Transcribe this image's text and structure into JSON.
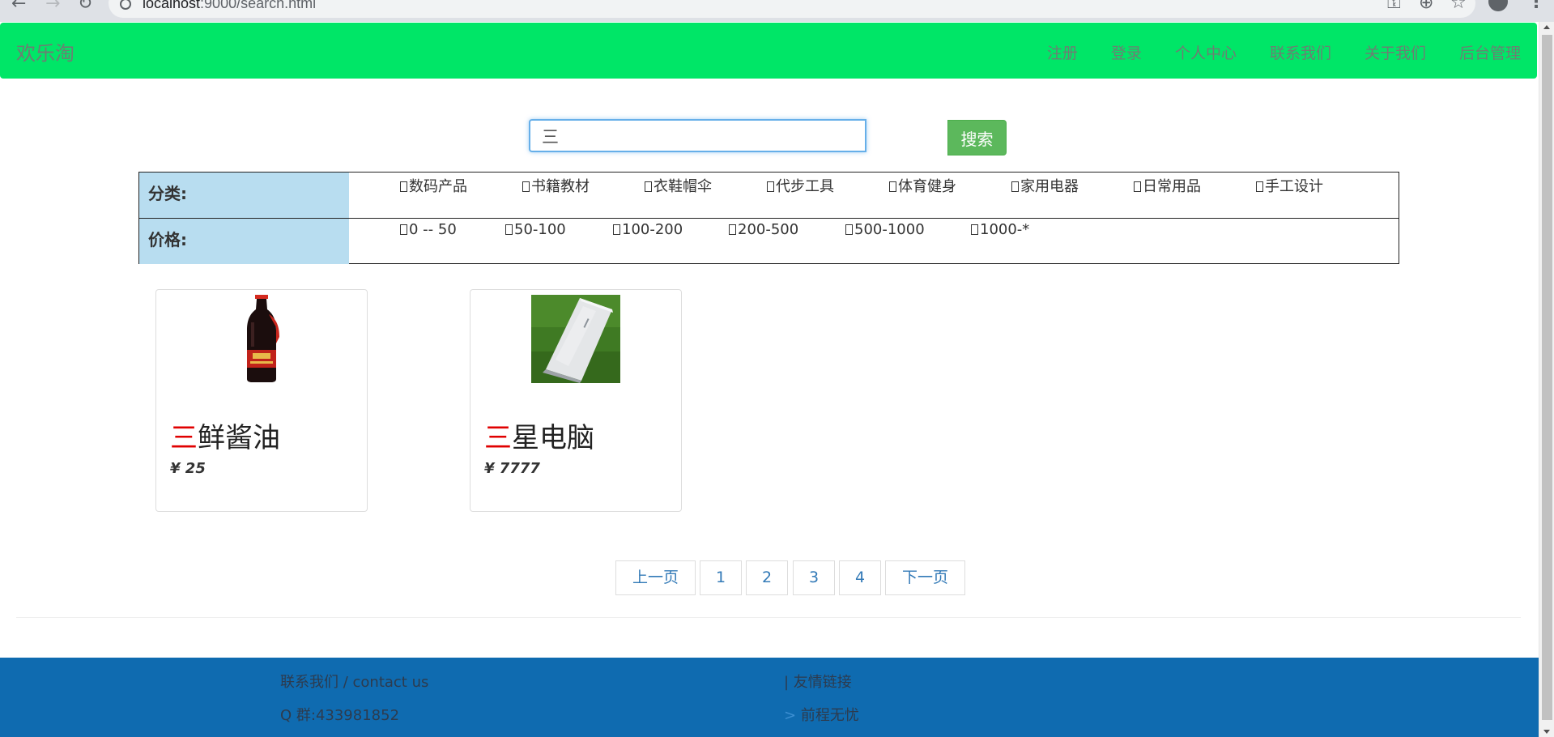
{
  "browser": {
    "url_host": "localhost",
    "url_rest": ":9000/search.html"
  },
  "navbar": {
    "brand": "欢乐淘",
    "links": [
      "注册",
      "登录",
      "个人中心",
      "联系我们",
      "关于我们",
      "后台管理"
    ]
  },
  "search": {
    "value": "三",
    "button_label": "搜索"
  },
  "filters": {
    "category_label": "分类:",
    "categories": [
      "数码产品",
      "书籍教材",
      "衣鞋帽伞",
      "代步工具",
      "体育健身",
      "家用电器",
      "日常用品",
      "手工设计"
    ],
    "price_label": "价格:",
    "prices": [
      "0 -- 50",
      "50-100",
      "100-200",
      "200-500",
      "500-1000",
      "1000-*"
    ]
  },
  "products": [
    {
      "highlight": "三",
      "name_rest": "鲜酱油",
      "price": "¥ 25",
      "image_icon": "soy-sauce-bottle"
    },
    {
      "highlight": "三",
      "name_rest": "星电脑",
      "price": "¥ 7777",
      "image_icon": "laptop-on-grass"
    }
  ],
  "pagination": {
    "prev": "上一页",
    "pages": [
      "1",
      "2",
      "3",
      "4"
    ],
    "next": "下一页"
  },
  "footer": {
    "contact_title": "联系我们 / contact us",
    "qq_group": "Q 群:433981852",
    "links_title": "| 友情链接",
    "link_marker": ">",
    "link_1": "前程无忧"
  },
  "colors": {
    "navbar_bg": "#00e667",
    "search_button": "#5cb85c",
    "filter_label_bg": "#b8ddf0",
    "highlight": "#e00000",
    "footer_bg": "#0f6bb0",
    "link": "#337ab7"
  }
}
